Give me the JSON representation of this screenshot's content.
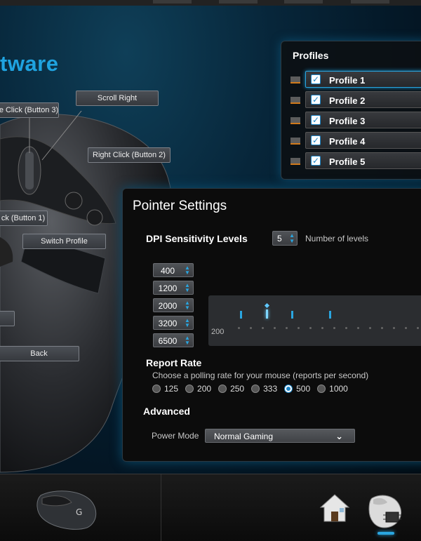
{
  "app": {
    "title_fragment": "tware"
  },
  "callouts": {
    "scroll_right": "Scroll Right",
    "middle_click": "e Click (Button 3)",
    "right_click": "Right Click (Button 2)",
    "left_click": "ck (Button 1)",
    "switch_profile": "Switch Profile",
    "back": "Back"
  },
  "profiles": {
    "title": "Profiles",
    "items": [
      {
        "label": "Profile 1",
        "checked": true,
        "active": true
      },
      {
        "label": "Profile 2",
        "checked": true
      },
      {
        "label": "Profile 3",
        "checked": true
      },
      {
        "label": "Profile 4",
        "checked": true
      },
      {
        "label": "Profile 5",
        "checked": true
      }
    ]
  },
  "pointer_settings": {
    "title": "Pointer Settings",
    "dpi": {
      "label": "DPI Sensitivity Levels",
      "count": "5",
      "count_label": "Number of levels",
      "levels": [
        "400",
        "1200",
        "2000",
        "3200",
        "6500"
      ],
      "graph_axis_label": "200"
    },
    "report_rate": {
      "label": "Report Rate",
      "description": "Choose a polling rate for your mouse (reports per second)",
      "options": [
        "125",
        "200",
        "250",
        "333",
        "500",
        "1000"
      ],
      "selected": "500"
    },
    "advanced": {
      "label": "Advanced",
      "power_mode_label": "Power Mode",
      "power_mode_value": "Normal Gaming"
    }
  },
  "nav": {
    "device_icon": "mouse-device-icon",
    "home_icon": "home-icon",
    "pointer_icon": "pointer-settings-icon"
  },
  "colors": {
    "accent": "#1fa3e0",
    "selection": "#1c84c6"
  }
}
